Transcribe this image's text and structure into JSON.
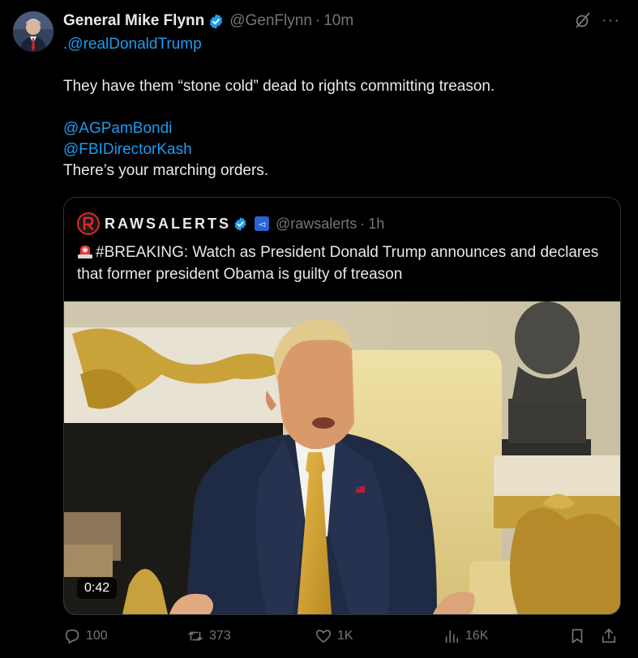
{
  "post": {
    "author_name": "General Mike Flynn",
    "author_handle": "@GenFlynn",
    "separator": "·",
    "time": "10m",
    "more_label": "···",
    "text": {
      "line1": ".@realDonaldTrump",
      "line2": "They have them “stone cold” dead to rights committing treason.",
      "line3": "@AGPamBondi",
      "line4": "@FBIDirectorKash",
      "line5": "There’s your marching orders."
    }
  },
  "quote": {
    "author_name": "RAWSALERTS",
    "author_handle": "@rawsalerts",
    "separator": "·",
    "time": "1h",
    "text": "#BREAKING: Watch as President Donald Trump announces and declares that former president Obama is guilty of treason",
    "video_duration": "0:42"
  },
  "actions": {
    "replies": "100",
    "reposts": "373",
    "likes": "1K",
    "views": "16K"
  },
  "colors": {
    "background": "#000000",
    "text": "#e7e9ea",
    "muted": "#71767b",
    "link": "#1d9bf0",
    "border": "#2f3336"
  }
}
